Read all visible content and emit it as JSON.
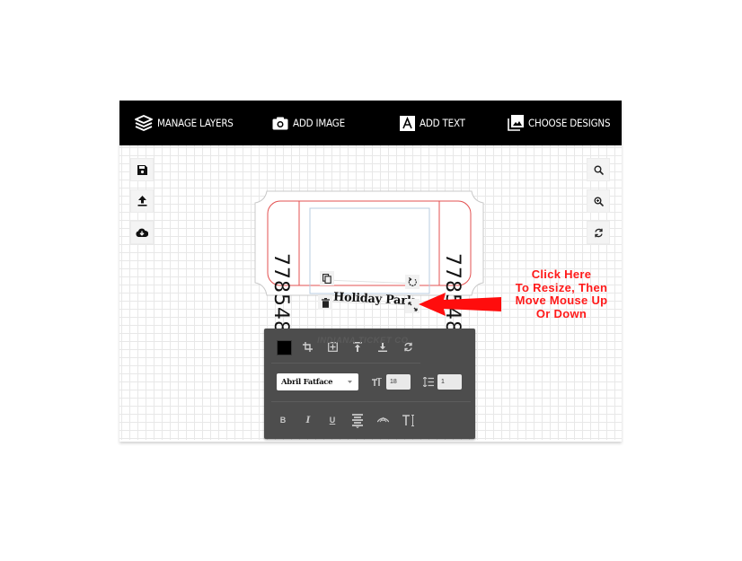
{
  "toolbar": {
    "items": [
      {
        "label": "MANAGE LAYERS",
        "icon": "layers-icon"
      },
      {
        "label": "ADD IMAGE",
        "icon": "camera-icon"
      },
      {
        "label": "ADD TEXT",
        "icon": "text-a-icon"
      },
      {
        "label": "CHOOSE DESIGNS",
        "icon": "gallery-icon"
      }
    ]
  },
  "left_tools": [
    {
      "name": "save",
      "icon": "save-icon"
    },
    {
      "name": "upload",
      "icon": "upload-icon"
    },
    {
      "name": "cloud-download",
      "icon": "cloud-download-icon"
    }
  ],
  "right_tools": [
    {
      "name": "zoom-out",
      "icon": "search-icon"
    },
    {
      "name": "zoom-in",
      "icon": "zoom-in-icon"
    },
    {
      "name": "reset",
      "icon": "refresh-icon"
    }
  ],
  "ticket": {
    "stub_number_left": "778548",
    "stub_number_right": "778548",
    "title_text": "Holiday Park",
    "footer_text": "INDIANA TICKET CO.",
    "border_color": "#e35050"
  },
  "text_panel": {
    "color_swatch": "#000000",
    "font_family": "Abril Fatface",
    "font_size": "18",
    "line_height": "1",
    "row1_tools": [
      "crop-icon",
      "grid-icon",
      "align-top-icon",
      "align-bottom-icon",
      "rotate-icon"
    ],
    "row3_tools": [
      {
        "label": "B",
        "name": "bold"
      },
      {
        "label": "I",
        "name": "italic"
      },
      {
        "label": "U",
        "name": "underline"
      },
      {
        "label": "",
        "name": "align-center"
      },
      {
        "label": "",
        "name": "curve-text"
      },
      {
        "label": "T",
        "name": "text-cursor"
      }
    ]
  },
  "annotation": {
    "lines": [
      "Click Here",
      "To Resize, Then",
      "Move Mouse Up",
      "Or Down"
    ],
    "color": "#ff0000"
  }
}
